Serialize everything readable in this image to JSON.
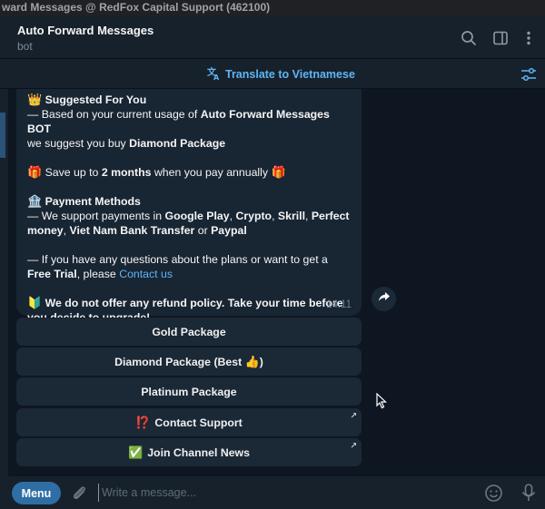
{
  "window": {
    "title": "ward Messages @ RedFox Capital Support (462100)"
  },
  "header": {
    "chat_title": "Auto Forward Messages",
    "chat_subtitle": "bot",
    "icons": [
      "search-icon",
      "sidebar-toggle-icon",
      "more-vert-icon"
    ]
  },
  "translate_bar": {
    "label": "Translate to Vietnamese",
    "icon": "translate-icon",
    "right_icon": "filter-sliders-icon"
  },
  "message": {
    "suggest_emoji": "👑",
    "suggest_title": "Suggested For You",
    "line1_a": "— Based on your current usage of ",
    "line1_b": "Auto Forward Messages BOT",
    "line2_a": "we suggest you buy ",
    "line2_b": "Diamond Package",
    "save_emoji": "🎁",
    "save_a": " Save up to ",
    "save_b": "2 months",
    "save_c": " when you pay annually ",
    "pay_emoji": "🏦",
    "pay_title": "Payment Methods",
    "pay_a": "— We support payments in ",
    "pay_b": "Google Play",
    "pay_c": ", ",
    "pay_d": "Crypto",
    "pay_e": ", ",
    "pay_f": "Skrill",
    "pay_g": ", ",
    "pay_h": "Perfect money",
    "pay_i": ", ",
    "pay_j": "Viet Nam Bank Transfer",
    "pay_k": " or ",
    "pay_l": "Paypal",
    "q_a": "— If you have any questions about the plans or want to get a ",
    "q_b": "Free Trial",
    "q_c": ", please ",
    "q_link": "Contact us",
    "warn_emoji": "🔰",
    "warn_text": "We do not offer any refund policy. Take your time before you decide to upgrade!",
    "time": "14:11"
  },
  "keyboard": {
    "gold": "Gold Package",
    "diamond": "Diamond Package (Best",
    "diamond_emoji": "👍",
    "diamond_close": ")",
    "platinum": "Platinum Package",
    "support_emoji": "⁉️",
    "support": "Contact Support",
    "channel_emoji": "✅",
    "channel": "Join Channel News",
    "external_arrow": "↗"
  },
  "composer": {
    "menu_label": "Menu",
    "placeholder": "Write a message...",
    "value": ""
  },
  "colors": {
    "accent": "#5eb5f7",
    "menu_button": "#2f6ea5",
    "bubble": "#182533",
    "background": "#0e1621"
  }
}
